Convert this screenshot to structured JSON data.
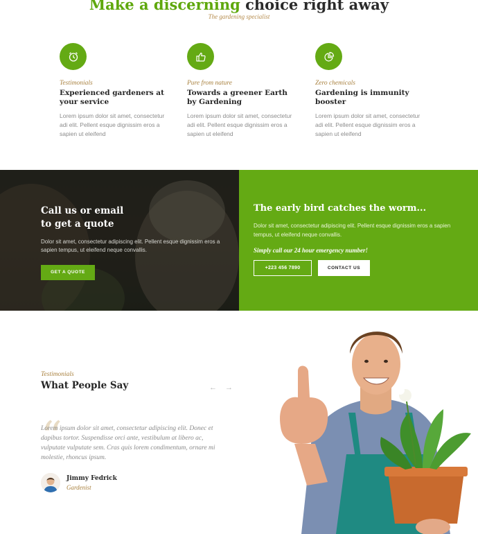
{
  "header": {
    "title_highlight": "Make a discerning",
    "title_rest": " choice right away",
    "subtitle": "The gardening specialist"
  },
  "features": [
    {
      "icon": "clock-icon",
      "kicker": "Testimonials",
      "title": "Experienced gardeners at your service",
      "text": "Lorem ipsum dolor sit amet, consectetur adi elit. Pellent esque dignissim eros a sapien ut eleifend"
    },
    {
      "icon": "thumbs-up-icon",
      "kicker": "Pure from nature",
      "title": "Towards a greener Earth by Gardening",
      "text": "Lorem ipsum dolor sit amet, consectetur adi elit. Pellent esque dignissim eros a sapien ut eleifend"
    },
    {
      "icon": "pie-chart-icon",
      "kicker": "Zero chemicals",
      "title": "Gardening is immunity booster",
      "text": "Lorem ipsum dolor sit amet, consectetur adi elit. Pellent esque dignissim eros a sapien ut eleifend"
    }
  ],
  "quote_band": {
    "title_line1": "Call us or email",
    "title_line2": "to get a quote",
    "text": "Dolor sit amet, consectetur adipiscing elit. Pellent esque dignissim eros a sapien tempus, ut eleifend neque convallis.",
    "button_label": "GET A QUOTE"
  },
  "emergency_band": {
    "title": "The early bird catches the worm...",
    "text": "Dolor sit amet, consectetur adipiscing elit. Pellent esque dignissim eros a sapien tempus, ut eleifend neque convallis.",
    "emergency_text": "Simply call our 24 hour emergency number!",
    "phone_label": "+223 456 7890",
    "contact_label": "CONTACT US"
  },
  "testimonials": {
    "kicker": "Testimonials",
    "title": "What People Say",
    "prev_arrow": "←",
    "next_arrow": "→",
    "quote_mark": "“",
    "quote": "Lorem ipsum dolor sit amet, consectetur adipiscing elit. Donec et dapibus tortor. Suspendisse orci ante, vestibulum at libero ac, vulputate vulputate sem. Cras quis lorem condimentum, ornare mi molestie, rhoncus ipsum.",
    "author_name": "Jimmy Fedrick",
    "author_role": "Gardenist"
  },
  "colors": {
    "accent_green": "#64aa14",
    "accent_gold": "#a8803e"
  }
}
